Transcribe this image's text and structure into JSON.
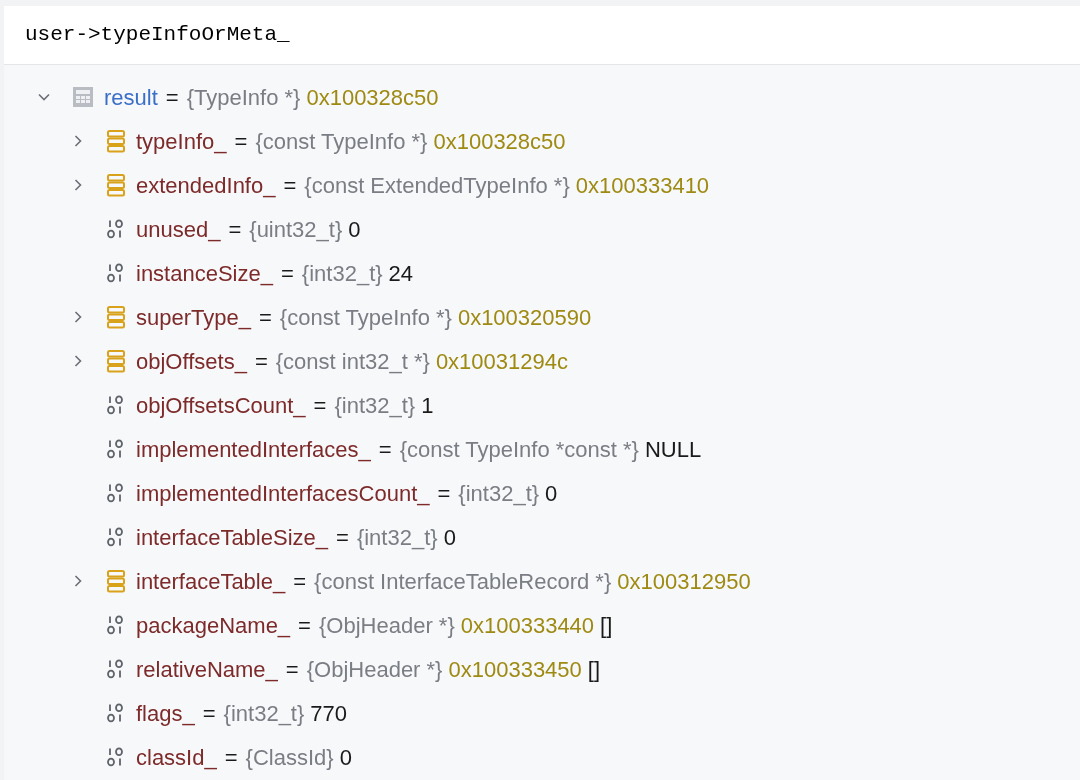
{
  "expression": "user->typeInfoOrMeta_",
  "tree": [
    {
      "kind": "object",
      "expanded": true,
      "name": "result",
      "operator": "=",
      "type": "{TypeInfo *}",
      "value": "0x100328c50",
      "color": "#9e8a12",
      "children": [
        {
          "kind": "pointer",
          "expanded": false,
          "name": "typeInfo_",
          "operator": "=",
          "type": "{const TypeInfo *}",
          "value": "0x100328c50",
          "color": "#9e8a12"
        },
        {
          "kind": "pointer",
          "expanded": false,
          "name": "extendedInfo_",
          "operator": "=",
          "type": "{const ExtendedTypeInfo *}",
          "value": "0x100333410",
          "color": "#9e8a12"
        },
        {
          "kind": "primitive",
          "name": "unused_",
          "operator": "=",
          "type": "{uint32_t}",
          "value": "0",
          "color": "#1a1a1a"
        },
        {
          "kind": "primitive",
          "name": "instanceSize_",
          "operator": "=",
          "type": "{int32_t}",
          "value": "24",
          "color": "#1a1a1a"
        },
        {
          "kind": "pointer",
          "expanded": false,
          "name": "superType_",
          "operator": "=",
          "type": "{const TypeInfo *}",
          "value": "0x100320590",
          "color": "#9e8a12"
        },
        {
          "kind": "pointer",
          "expanded": false,
          "name": "objOffsets_",
          "operator": "=",
          "type": "{const int32_t *}",
          "value": "0x10031294c",
          "color": "#9e8a12"
        },
        {
          "kind": "primitive",
          "name": "objOffsetsCount_",
          "operator": "=",
          "type": "{int32_t}",
          "value": "1",
          "color": "#1a1a1a"
        },
        {
          "kind": "primitive",
          "name": "implementedInterfaces_",
          "operator": "=",
          "type": "{const TypeInfo *const *}",
          "value": "NULL",
          "color": "#1a1a1a"
        },
        {
          "kind": "primitive",
          "name": "implementedInterfacesCount_",
          "operator": "=",
          "type": "{int32_t}",
          "value": "0",
          "color": "#1a1a1a"
        },
        {
          "kind": "primitive",
          "name": "interfaceTableSize_",
          "operator": "=",
          "type": "{int32_t}",
          "value": "0",
          "color": "#1a1a1a"
        },
        {
          "kind": "pointer",
          "expanded": false,
          "name": "interfaceTable_",
          "operator": "=",
          "type": "{const InterfaceTableRecord *}",
          "value": "0x100312950",
          "color": "#9e8a12"
        },
        {
          "kind": "primitive",
          "name": "packageName_",
          "operator": "=",
          "type": "{ObjHeader *}",
          "value": "0x100333440",
          "color": "#9e8a12",
          "suffix": "[]"
        },
        {
          "kind": "primitive",
          "name": "relativeName_",
          "operator": "=",
          "type": "{ObjHeader *}",
          "value": "0x100333450",
          "color": "#9e8a12",
          "suffix": "[]"
        },
        {
          "kind": "primitive",
          "name": "flags_",
          "operator": "=",
          "type": "{int32_t}",
          "value": "770",
          "color": "#1a1a1a"
        },
        {
          "kind": "primitive",
          "name": "classId_",
          "operator": "=",
          "type": "{ClassId}",
          "value": "0",
          "color": "#1a1a1a"
        }
      ]
    }
  ]
}
